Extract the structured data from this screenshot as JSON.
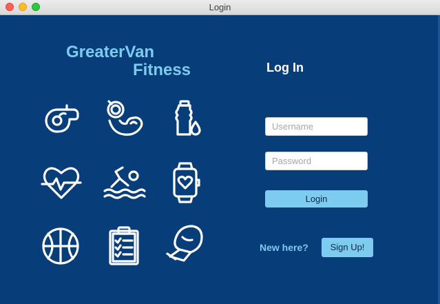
{
  "window": {
    "title": "Login"
  },
  "brand": {
    "line1": "GreaterVan",
    "line2": "Fitness"
  },
  "icons": [
    "whistle-icon",
    "bicep-icon",
    "water-bottle-icon",
    "heart-rate-icon",
    "swimmer-icon",
    "smartwatch-icon",
    "basketball-icon",
    "clipboard-icon",
    "boxing-glove-icon"
  ],
  "form": {
    "heading": "Log In",
    "username_placeholder": "Username",
    "password_placeholder": "Password",
    "login_label": "Login",
    "new_here": "New here?",
    "signup_label": "Sign Up!"
  },
  "colors": {
    "background": "#073d79",
    "accent": "#7ecbf0",
    "icon": "#ffffff"
  }
}
